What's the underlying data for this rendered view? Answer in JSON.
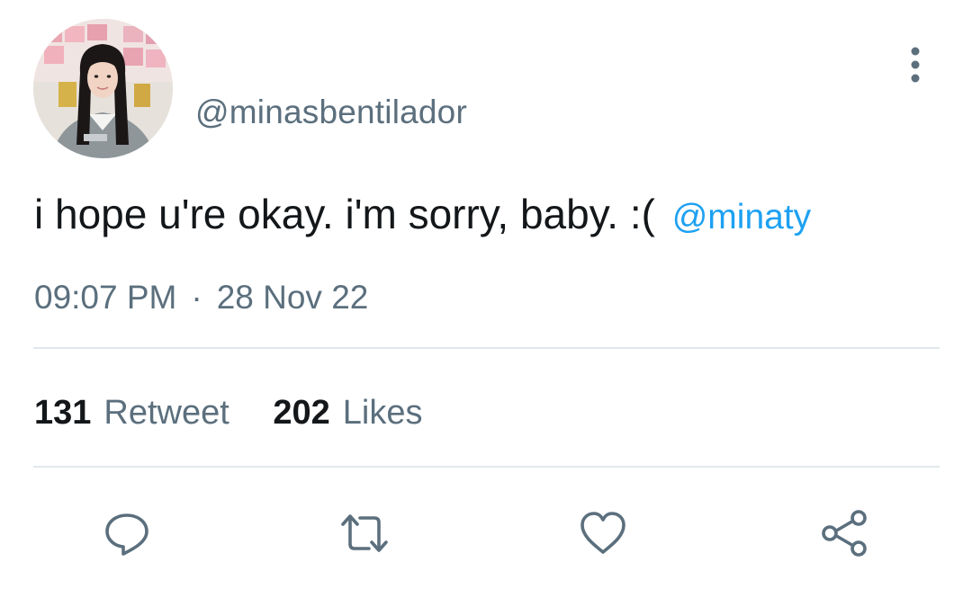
{
  "tweet": {
    "handle": "@minasbentilador",
    "text": "i hope u're okay. i'm sorry, baby. :(",
    "mention": "@minaty",
    "time": "09:07 PM",
    "separator": "·",
    "date": "28 Nov 22"
  },
  "stats": {
    "retweets_count": "131",
    "retweets_label": "Retweet",
    "likes_count": "202",
    "likes_label": "Likes"
  },
  "icons": {
    "menu": "more-vertical-icon",
    "reply": "reply-icon",
    "retweet": "retweet-icon",
    "like": "heart-icon",
    "share": "share-icon"
  },
  "colors": {
    "text": "#14171a",
    "secondary": "#5b6f7d",
    "mention": "#1da1f2",
    "divider": "#e1e8ed"
  }
}
